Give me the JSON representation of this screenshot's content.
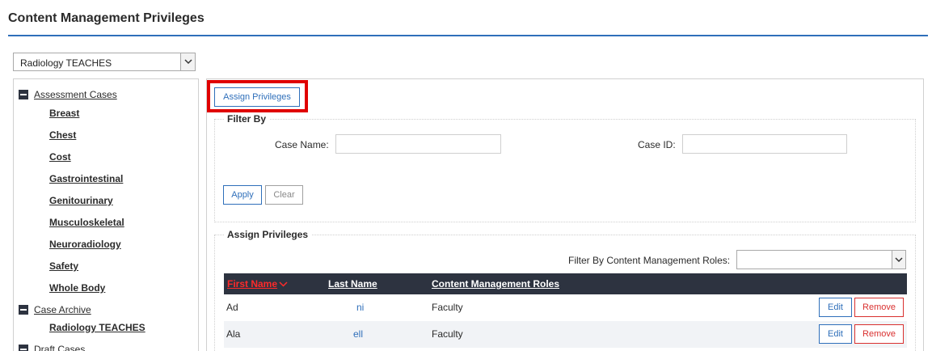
{
  "page": {
    "title": "Content Management Privileges"
  },
  "program_select": {
    "value": "Radiology TEACHES"
  },
  "tree": {
    "groups": [
      {
        "label": "Assessment Cases",
        "children": [
          "Breast",
          "Chest",
          "Cost",
          "Gastrointestinal",
          "Genitourinary",
          "Musculoskeletal",
          "Neuroradiology",
          "Safety",
          "Whole Body"
        ]
      },
      {
        "label": "Case Archive",
        "children": [
          "Radiology TEACHES"
        ]
      },
      {
        "label": "Draft Cases",
        "children": []
      }
    ]
  },
  "toolbar": {
    "assign_label": "Assign Privileges"
  },
  "filter": {
    "legend": "Filter By",
    "case_name_label": "Case Name:",
    "case_name_value": "",
    "case_id_label": "Case ID:",
    "case_id_value": "",
    "apply_label": "Apply",
    "clear_label": "Clear"
  },
  "assign": {
    "legend": "Assign Privileges",
    "roles_filter_label": "Filter By Content Management Roles:",
    "roles_filter_value": ""
  },
  "grid": {
    "columns": [
      "First Name",
      "Last Name",
      "Content Management Roles"
    ],
    "rows": [
      {
        "first": "Ad",
        "last": "ni",
        "role": "Faculty"
      },
      {
        "first": "Ala",
        "last": "ell",
        "role": "Faculty"
      }
    ],
    "edit_label": "Edit",
    "remove_label": "Remove"
  },
  "colors": {
    "accent": "#2f6fba",
    "header_bg": "#2d3340",
    "danger": "#d9302f",
    "highlight": "#e00000"
  }
}
